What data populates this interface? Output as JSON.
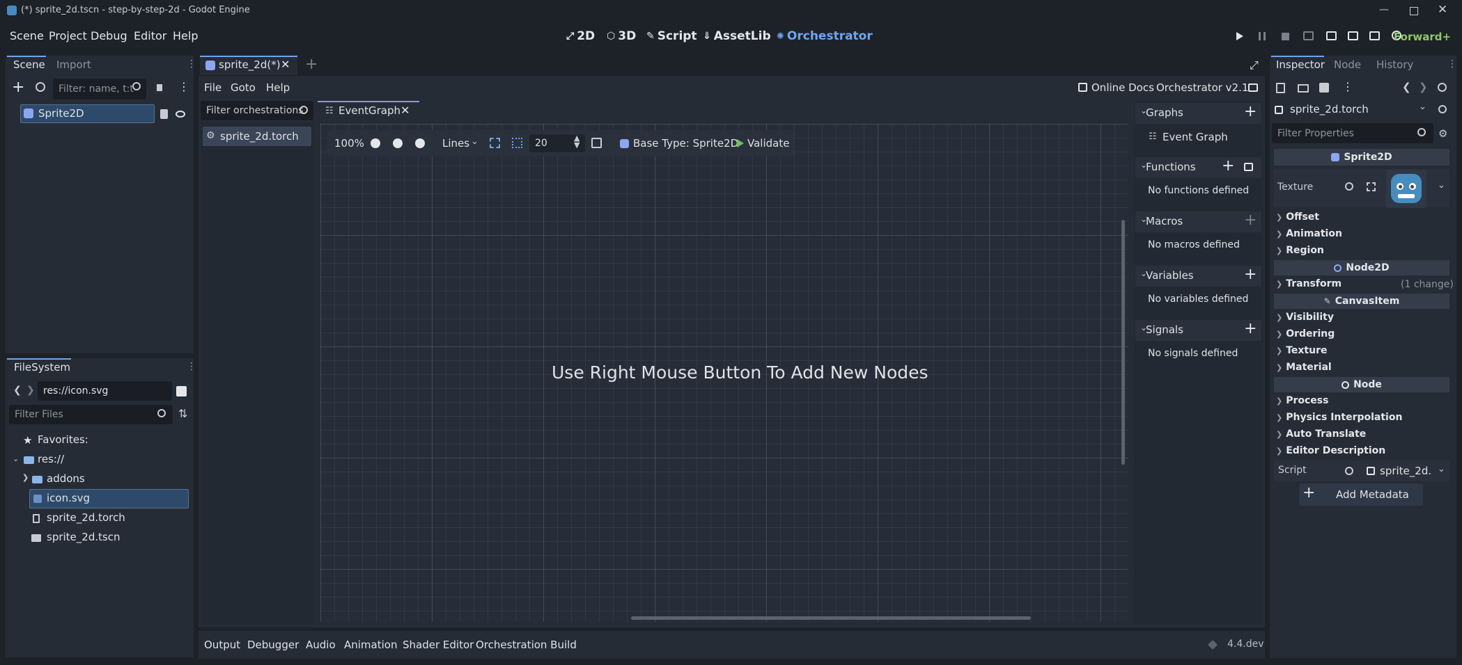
{
  "window": {
    "title": "(*) sprite_2d.tscn - step-by-step-2d - Godot Engine",
    "controls": [
      "minimize",
      "maximize",
      "close"
    ]
  },
  "menu": {
    "items": [
      "Scene",
      "Project",
      "Debug",
      "Editor",
      "Help"
    ]
  },
  "workspaces": [
    {
      "label": "2D",
      "icon": "2d-icon"
    },
    {
      "label": "3D",
      "icon": "3d-icon"
    },
    {
      "label": "Script",
      "icon": "script-icon"
    },
    {
      "label": "AssetLib",
      "icon": "assetlib-icon"
    },
    {
      "label": "Orchestrator",
      "icon": "orchestrator-icon",
      "active": true
    }
  ],
  "run_bar": {
    "renderer": "Forward+"
  },
  "scene_dock": {
    "tabs": [
      "Scene",
      "Import"
    ],
    "filter_placeholder": "Filter: name, t:t",
    "tree": [
      {
        "label": "Sprite2D",
        "selected": true
      }
    ]
  },
  "filesystem_dock": {
    "tab": "FileSystem",
    "path": "res://icon.svg",
    "filter_placeholder": "Filter Files",
    "favorites_label": "Favorites:",
    "tree": [
      {
        "label": "res://",
        "type": "folder",
        "depth": 0
      },
      {
        "label": "addons",
        "type": "folder",
        "depth": 1
      },
      {
        "label": "icon.svg",
        "type": "image",
        "depth": 1,
        "selected": true
      },
      {
        "label": "sprite_2d.torch",
        "type": "file",
        "depth": 1
      },
      {
        "label": "sprite_2d.tscn",
        "type": "scene",
        "depth": 1
      }
    ]
  },
  "editor_tabs": {
    "active_tab": "sprite_2d(*)"
  },
  "orchestrator": {
    "menu": [
      "File",
      "Goto",
      "Help"
    ],
    "online_docs": "Online Docs",
    "version": "Orchestrator v2.1",
    "filter_placeholder": "Filter orchestrations",
    "files": [
      {
        "label": "sprite_2d.torch",
        "selected": true
      }
    ],
    "graph_tab": "EventGraph",
    "toolbar": {
      "zoom": "100%",
      "grid_pattern": "Lines",
      "snap_value": "20",
      "base_type": "Base Type: Sprite2D",
      "validate": "Validate"
    },
    "hint": "Use Right Mouse Button To Add New Nodes",
    "sections": [
      {
        "title": "Graphs",
        "items": [
          "Event Graph"
        ]
      },
      {
        "title": "Functions",
        "empty": "No functions defined"
      },
      {
        "title": "Macros",
        "empty": "No macros defined"
      },
      {
        "title": "Variables",
        "empty": "No variables defined"
      },
      {
        "title": "Signals",
        "empty": "No signals defined"
      }
    ]
  },
  "bottom_panel": {
    "tabs": [
      "Output",
      "Debugger",
      "Audio",
      "Animation",
      "Shader Editor",
      "Orchestration Build"
    ],
    "version": "4.4.dev"
  },
  "inspector": {
    "tabs": [
      "Inspector",
      "Node",
      "History"
    ],
    "resource": "sprite_2d.torch",
    "filter_placeholder": "Filter Properties",
    "classes": {
      "sprite2d": "Sprite2D",
      "node2d": "Node2D",
      "canvasitem": "CanvasItem",
      "node": "Node"
    },
    "texture_label": "Texture",
    "sprite_groups": [
      "Offset",
      "Animation",
      "Region"
    ],
    "transform": {
      "label": "Transform",
      "note": "(1 change)"
    },
    "canvas_groups": [
      "Visibility",
      "Ordering",
      "Texture",
      "Material"
    ],
    "node_groups": [
      "Process",
      "Physics Interpolation",
      "Auto Translate",
      "Editor Description"
    ],
    "script_label": "Script",
    "script_value": "sprite_2d.",
    "add_metadata": "Add Metadata"
  },
  "colors": {
    "accent": "#6fa5ee",
    "renderer": "#8fc965",
    "validate": "#6dc35a"
  }
}
